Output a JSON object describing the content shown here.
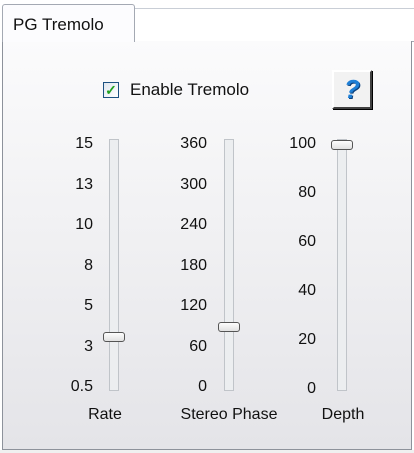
{
  "tab": {
    "label": "PG Tremolo"
  },
  "enable": {
    "label": "Enable Tremolo",
    "checked": true,
    "check_glyph": "✓"
  },
  "help": {
    "glyph": "?",
    "icon": "help-icon"
  },
  "sliders": {
    "rate": {
      "label": "Rate",
      "ticks": [
        "15",
        "13",
        "10",
        "8",
        "5",
        "3",
        "0.5"
      ],
      "value": 3.5
    },
    "stereo_phase": {
      "label": "Stereo Phase",
      "ticks": [
        "360",
        "300",
        "240",
        "180",
        "120",
        "60",
        "0"
      ],
      "value": 90
    },
    "depth": {
      "label": "Depth",
      "ticks": [
        "100",
        "80",
        "60",
        "40",
        "20",
        "0"
      ],
      "value": 100
    }
  }
}
